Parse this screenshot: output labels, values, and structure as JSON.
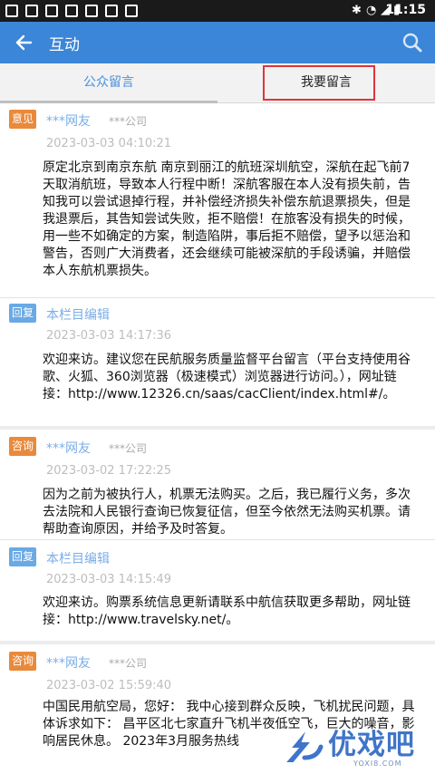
{
  "status_bar": {
    "time": "11:15"
  },
  "app_bar": {
    "title": "互动"
  },
  "tabs": [
    {
      "label": "公众留言",
      "selected": true
    },
    {
      "label": "我要留言",
      "selected": false
    }
  ],
  "messages": [
    {
      "type": "comment",
      "badge": "意见",
      "name": "***网友",
      "company": "***公司",
      "date": "2023-03-03 04:10:21",
      "text": "原定北京到南京东航 南京到丽江的航班深圳航空，深航在起飞前7天取消航班，导致本人行程中断！深航客服在本人没有损失前，告知我可以尝试退掉行程，并补偿经济损失补偿东航退票损失，但是我退票后，其告知尝试失败，拒不赔偿！在旅客没有损失的时候，用一些不如确定的方案，制造陷阱，事后拒不赔偿，望予以惩治和警告，否则广大消费者，还会继续可能被深航的手段诱骗，并赔偿本人东航机票损失。"
    },
    {
      "type": "reply",
      "badge": "回复",
      "name": "本栏目编辑",
      "date": "2023-03-03 14:17:36",
      "text": "欢迎来访。建议您在民航服务质量监督平台留言（平台支持使用谷歌、火狐、360浏览器（极速模式）浏览器进行访问。），网址链接：http://www.12326.cn/saas/cacClient/index.html#/。"
    },
    {
      "type": "comment",
      "badge": "咨询",
      "name": "***网友",
      "company": "***公司",
      "date": "2023-03-02 17:22:25",
      "text": "因为之前为被执行人，机票无法购买。之后，我已履行义务，多次去法院和人民银行查询已恢复征信，但至今依然无法购买机票。请帮助查询原因，并给予及时答复。"
    },
    {
      "type": "reply",
      "badge": "回复",
      "name": "本栏目编辑",
      "date": "2023-03-03 14:15:49",
      "text": "欢迎来访。购票系统信息更新请联系中航信获取更多帮助，网址链接：http://www.travelsky.net/。"
    },
    {
      "type": "comment",
      "badge": "咨询",
      "name": "***网友",
      "company": "***公司",
      "date": "2023-03-02 15:59:40",
      "text": "中国民用航空局，您好： 我中心接到群众反映，飞机扰民问题，具体诉求如下： 昌平区北七家直升飞机半夜低空飞，巨大的噪音，影响居民休息。 2023年3月服务热线"
    }
  ],
  "watermark": {
    "text": "优戏吧",
    "url": "YOXI8.COM"
  },
  "colors": {
    "app_bar": "#3b86d8",
    "badge_comment": "#e98a3b",
    "badge_reply": "#6aa9e4",
    "tab_highlight": "#e0343a"
  }
}
